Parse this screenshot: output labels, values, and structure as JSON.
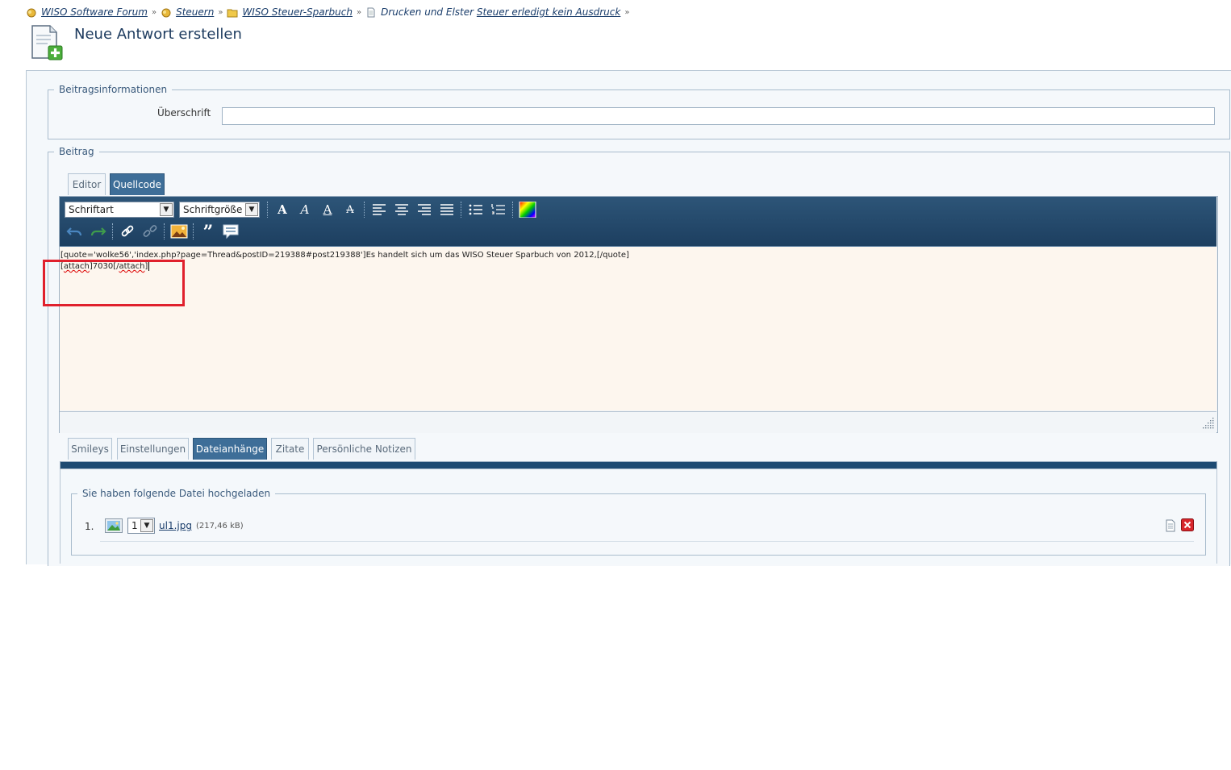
{
  "breadcrumb": {
    "items": [
      "WISO Software Forum",
      "Steuern",
      "WISO Steuer-Sparbuch"
    ],
    "thread_prefix": "Drucken und Elster",
    "thread_link": "Steuer erledigt kein Ausdruck",
    "separator": "»"
  },
  "page_title": "Neue Antwort erstellen",
  "post_info": {
    "legend": "Beitragsinformationen",
    "subject_label": "Überschrift",
    "subject_value": ""
  },
  "post": {
    "legend": "Beitrag",
    "tabs": [
      "Editor",
      "Quellcode"
    ],
    "active_tab": "Quellcode",
    "toolbar": {
      "font_select": "Schriftart",
      "size_select": "Schriftgröße",
      "quote_glyph": "”"
    },
    "text_lines": [
      "[quote='wolke56','index.php?page=Thread&postID=219388#post219388']Es handelt sich um das WISO Steuer Sparbuch von 2012,[/quote]",
      ""
    ],
    "attach_line": {
      "open_tag": "attach",
      "value": "7030",
      "close_tag": "attach"
    }
  },
  "bottom_tabs": {
    "items": [
      "Smileys",
      "Einstellungen",
      "Dateianhänge",
      "Zitate",
      "Persönliche Notizen"
    ],
    "active": "Dateianhänge"
  },
  "attachments": {
    "legend": "Sie haben folgende Datei hochgeladen",
    "files": [
      {
        "number": "1.",
        "position": "1",
        "name": "ul1.jpg",
        "size": "(217,46 kB)"
      }
    ]
  },
  "colors": {
    "toolbar": "#1d3f60",
    "active_tab": "#3e6e98",
    "editor_bg": "#fdf6ee",
    "highlight": "#e0202c",
    "link": "#1a3d6b"
  }
}
